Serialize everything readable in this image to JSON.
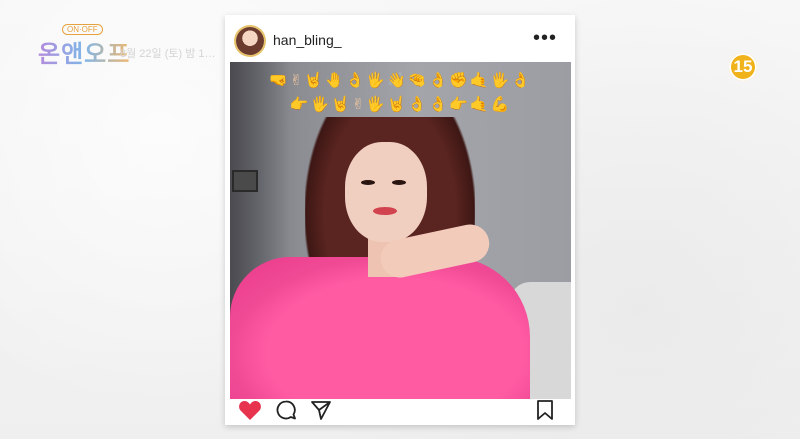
{
  "show": {
    "tag": "ON·OFF",
    "title": "온앤오프",
    "schedule": "8월 22일 (토) 밤 1…"
  },
  "rating": "15",
  "post": {
    "username": "han_bling_",
    "more_label": "•••",
    "emoji_rows": [
      "🤜✌🤘🤚👌🖐👋🤏👌✊🤙🖐👌",
      "👉🖐🤘✌🖐🤘👌👌👉🤙💪"
    ]
  },
  "colors": {
    "heart": "#e8334f",
    "rating_badge": "#f1b31c",
    "blouse": "#ff5ba3"
  }
}
